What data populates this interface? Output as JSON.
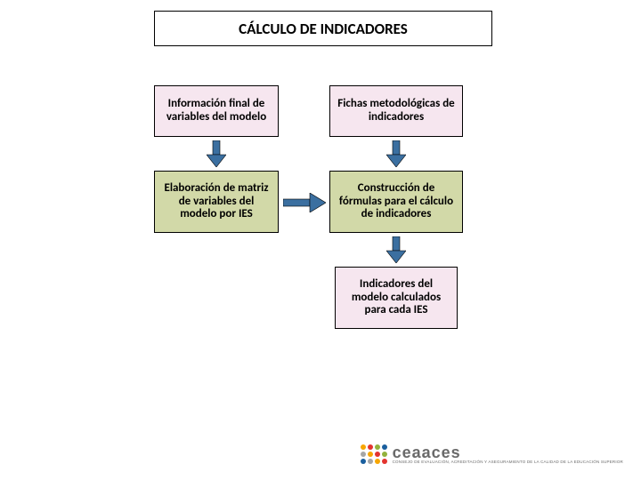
{
  "title": "CÁLCULO DE INDICADORES",
  "nodes": {
    "info_final": "Información final de variables del modelo",
    "fichas": "Fichas metodológicas de indicadores",
    "elaboracion": "Elaboración de matriz de variables del modelo por IES",
    "construccion": "Construcción de fórmulas para el cálculo de indicadores",
    "indicadores": "Indicadores del modelo calculados para cada IES"
  },
  "logo": {
    "name": "ceaaces",
    "sub": "CONSEJO DE EVALUACIÓN, ACREDITACIÓN Y ASEGURAMIENTO DE LA CALIDAD DE LA EDUCACIÓN SUPERIOR"
  },
  "colors": {
    "pink": "#f6e6ef",
    "olive": "#d2d9a8",
    "logo_dots": [
      "#f7a600",
      "#e3342f",
      "#93b23c",
      "#1a5f9e",
      "#a6a6a6"
    ]
  }
}
